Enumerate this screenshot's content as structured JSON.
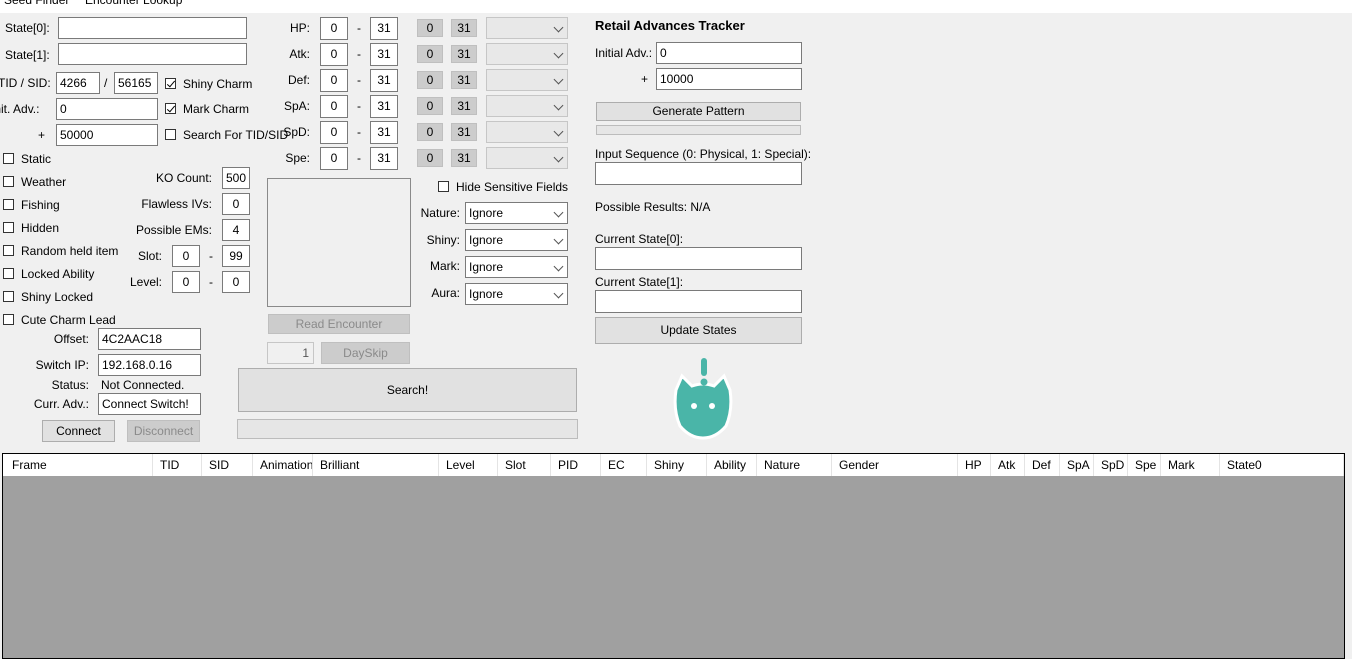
{
  "menu": {
    "tabs": [
      "Seed Finder",
      "Encounter Lookup"
    ]
  },
  "rng": {
    "state0_label": "State[0]:",
    "state0_value": "",
    "state1_label": "State[1]:",
    "state1_value": "",
    "tid_sid_label": "TID / SID:",
    "tid": "4266",
    "slash": "/",
    "sid": "56165",
    "init_adv_label": "Init. Adv.:",
    "init_adv": "0",
    "plus": "+",
    "max_adv": "50000",
    "shiny_charm": "Shiny Charm",
    "mark_charm": "Mark Charm",
    "search_tid_sid": "Search For TID/SID"
  },
  "filters": [
    {
      "label": "Static"
    },
    {
      "label": "Weather"
    },
    {
      "label": "Fishing"
    },
    {
      "label": "Hidden"
    },
    {
      "label": "Random held item"
    },
    {
      "label": "Locked Ability"
    },
    {
      "label": "Shiny Locked"
    },
    {
      "label": "Cute Charm Lead"
    }
  ],
  "encounter": {
    "ko_label": "KO Count:",
    "ko": "500",
    "flawless_label": "Flawless IVs:",
    "flawless": "0",
    "ems_label": "Possible EMs:",
    "ems": "4",
    "slot_label": "Slot:",
    "slot_min": "0",
    "slot_max": "99",
    "level_label": "Level:",
    "level_min": "0",
    "level_max": "0",
    "dash": "-"
  },
  "ivs": [
    {
      "label": "HP:",
      "min": "0",
      "max": "31",
      "a": "0",
      "b": "31"
    },
    {
      "label": "Atk:",
      "min": "0",
      "max": "31",
      "a": "0",
      "b": "31"
    },
    {
      "label": "Def:",
      "min": "0",
      "max": "31",
      "a": "0",
      "b": "31"
    },
    {
      "label": "SpA:",
      "min": "0",
      "max": "31",
      "a": "0",
      "b": "31"
    },
    {
      "label": "SpD:",
      "min": "0",
      "max": "31",
      "a": "0",
      "b": "31"
    },
    {
      "label": "Spe:",
      "min": "0",
      "max": "31",
      "a": "0",
      "b": "31"
    }
  ],
  "options": {
    "hide_sensitive": "Hide Sensitive Fields",
    "nature_label": "Nature:",
    "nature": "Ignore",
    "shiny_label": "Shiny:",
    "shiny": "Ignore",
    "mark_label": "Mark:",
    "mark": "Ignore",
    "aura_label": "Aura:",
    "aura": "Ignore"
  },
  "connection": {
    "read_encounter": "Read Encounter",
    "dayskip_count": "1",
    "dayskip": "DaySkip",
    "offset_label": "Offset:",
    "offset": "4C2AAC18",
    "ip_label": "Switch IP:",
    "ip": "192.168.0.16",
    "status_label": "Status:",
    "status": "Not Connected.",
    "curr_adv_label": "Curr. Adv.:",
    "curr_adv": "Connect Switch!",
    "connect": "Connect",
    "disconnect": "Disconnect",
    "search": "Search!"
  },
  "tracker": {
    "title": "Retail Advances Tracker",
    "initial_label": "Initial Adv.:",
    "initial": "0",
    "plus": "+",
    "range": "10000",
    "generate": "Generate Pattern",
    "input_label": "Input Sequence (0: Physical, 1: Special):",
    "input": "",
    "results": "Possible Results: N/A",
    "cs0_label": "Current State[0]:",
    "cs0": "",
    "cs1_label": "Current State[1]:",
    "cs1": "",
    "update": "Update States"
  },
  "results_table": {
    "columns": [
      "Frame",
      "TID",
      "SID",
      "Animation",
      "Brilliant",
      "Level",
      "Slot",
      "PID",
      "EC",
      "Shiny",
      "Ability",
      "Nature",
      "Gender",
      "HP",
      "Atk",
      "Def",
      "SpA",
      "SpD",
      "Spe",
      "Mark",
      "State0"
    ]
  },
  "colors": {
    "mascot": "#4ab5a8",
    "grid_bg": "#a0a0a0"
  }
}
